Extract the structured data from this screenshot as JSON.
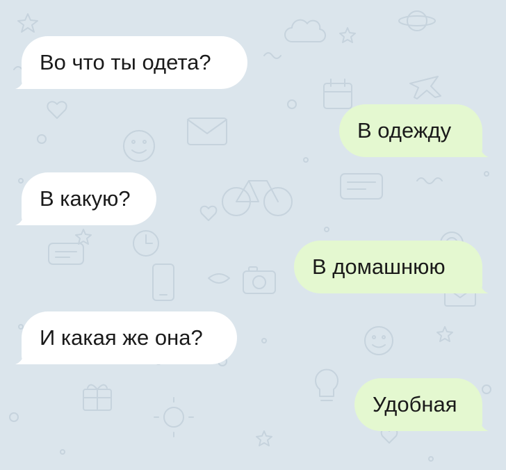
{
  "messages": [
    {
      "text": "Во что ты одета?",
      "side": "in"
    },
    {
      "text": "В одежду",
      "side": "out"
    },
    {
      "text": "В какую?",
      "side": "in"
    },
    {
      "text": "В домашнюю",
      "side": "out"
    },
    {
      "text": "И какая же она?",
      "side": "in"
    },
    {
      "text": "Удобная",
      "side": "out"
    }
  ],
  "colors": {
    "background": "#dbe5ec",
    "incoming_bubble": "#ffffff",
    "outgoing_bubble": "#e4f8d0",
    "doodle": "#c6d3dd"
  }
}
